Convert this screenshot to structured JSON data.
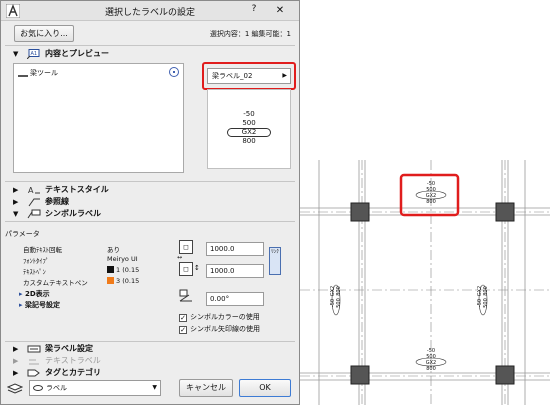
{
  "dialog": {
    "title": "選択したラベルの設定",
    "help": "?",
    "close": "✕",
    "favorites_button": "お気に入り...",
    "selection_info": "選択内容：1 編集可能：1"
  },
  "sections": {
    "content_preview": "内容とプレビュー",
    "text_style": "テキストスタイル",
    "leader": "参照線",
    "symbol_label": "シンボルラベル",
    "beam_label_settings": "梁ラベル設定",
    "text_label": "テキストラベル",
    "tags_categories": "タグとカテゴリ"
  },
  "preview": {
    "tool_item": "梁ツール",
    "label_dropdown": "梁ラベル_02",
    "lines": [
      "-50",
      "500",
      "GX2",
      "800"
    ]
  },
  "parameters": {
    "heading": "パラメータ",
    "rows": [
      {
        "name": "自動ﾃｷｽﾄ回転",
        "value": "あり"
      },
      {
        "name": "ﾌｫﾝﾄﾀｲﾌﾟ",
        "value": "Meiryo UI"
      },
      {
        "name": "ﾃｷｽﾄﾍﾟﾝ",
        "value": "1 (0.15"
      },
      {
        "name": "カスタムテキストペン",
        "value": "3 (0.15"
      }
    ],
    "sub_items": [
      "2D表示",
      "梁記号設定"
    ],
    "width_value": "1000.0",
    "height_value": "1000.0",
    "angle_value": "0.00°",
    "side_button": "ﾘﾝｸ",
    "use_symbol_color": "シンボルカラーの使用",
    "use_symbol_arrow": "シンボル矢印線の使用",
    "pen_colors": {
      "pen1": "#111111",
      "pen3": "#f07b1a"
    }
  },
  "footer": {
    "layer": "ラベル",
    "cancel": "キャンセル",
    "ok": "OK"
  },
  "plan": {
    "tag_top": [
      "-50",
      "500",
      "GX2",
      "800"
    ],
    "tag_bottom": [
      "-50",
      "500",
      "GX2",
      "800"
    ],
    "tag_left": [
      "-50",
      "500",
      "GX2",
      "800"
    ],
    "tag_right": [
      "-50",
      "500",
      "GX2",
      "800"
    ]
  },
  "colors": {
    "highlight": "#e01d1d",
    "accent_blue": "#3d7bd4"
  }
}
